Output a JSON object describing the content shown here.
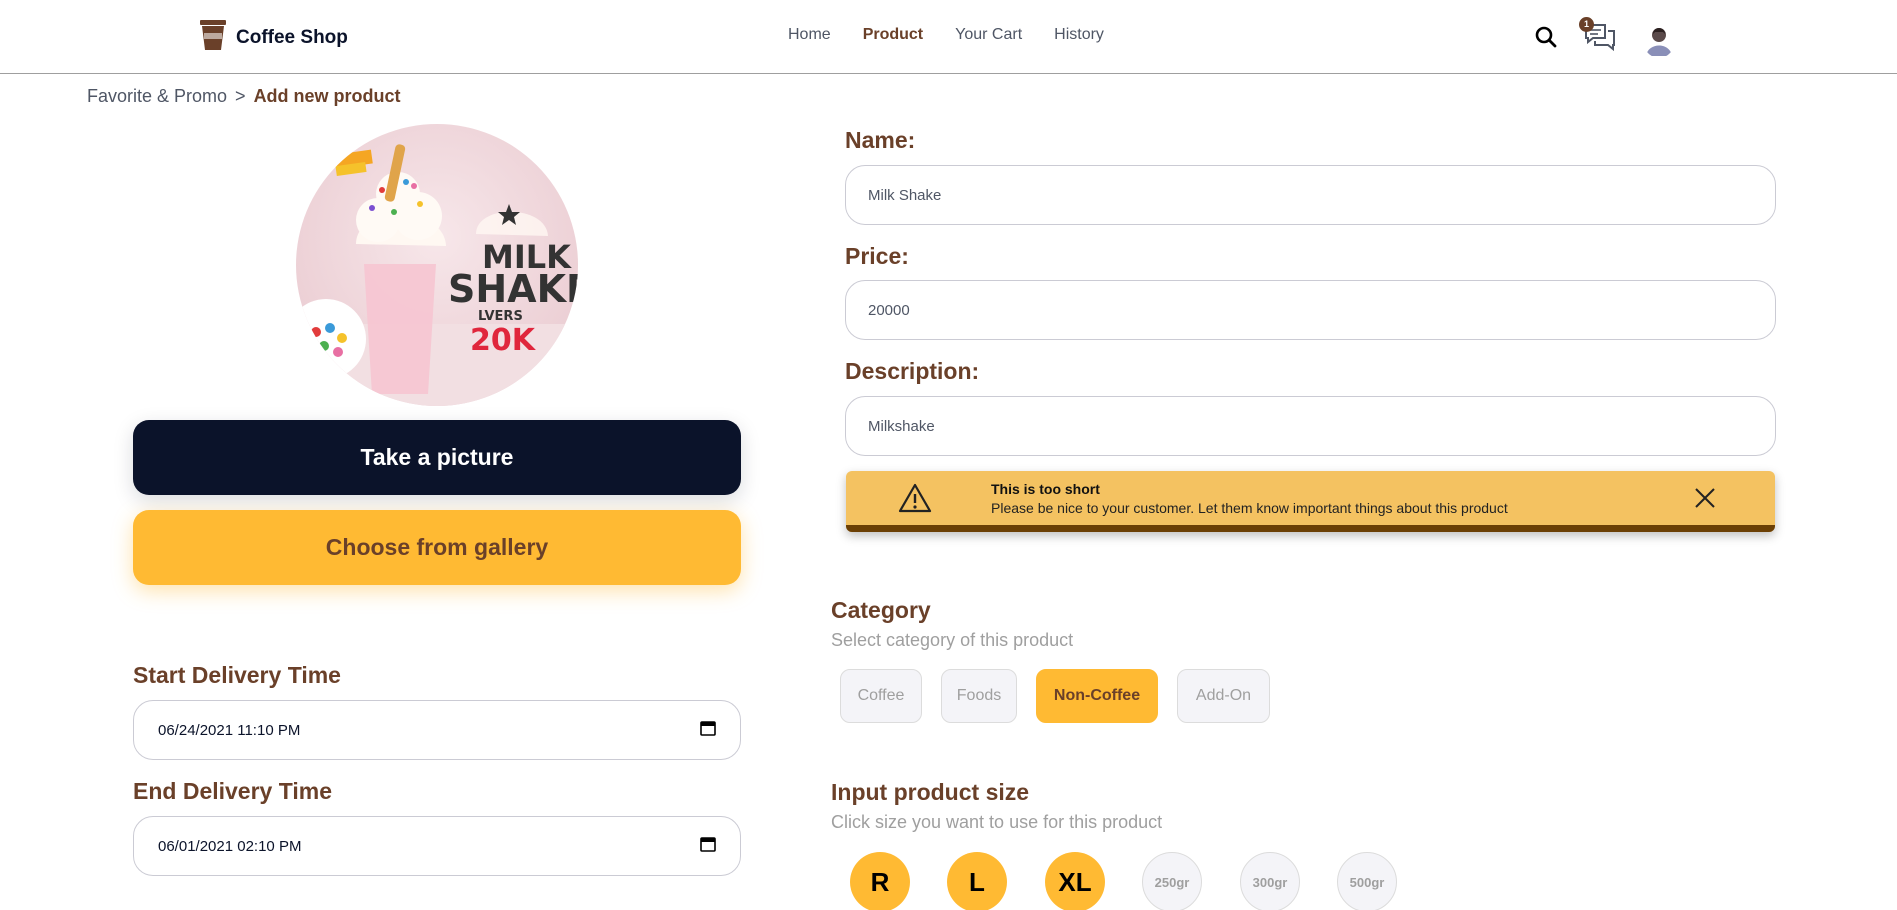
{
  "header": {
    "brand": "Coffee Shop",
    "nav": [
      "Home",
      "Product",
      "Your Cart",
      "History"
    ],
    "active_nav": "Product",
    "chat_badge": "1",
    "icons": [
      "search-icon",
      "chat-icon",
      "avatar"
    ]
  },
  "breadcrumb": {
    "parent": "Favorite & Promo",
    "separator": ">",
    "current": "Add new product"
  },
  "image_panel": {
    "take_picture_label": "Take a picture",
    "choose_gallery_label": "Choose from gallery",
    "image_text": {
      "line1": "MILK",
      "line2": "SHAKE",
      "line3": "LVERS",
      "price": "20K"
    }
  },
  "delivery": {
    "start_label": "Start Delivery Time",
    "start_value": "06/24/2021 11:10 PM",
    "end_label": "End Delivery Time",
    "end_value": "06/01/2021 02:10 PM"
  },
  "form": {
    "name_label": "Name:",
    "name_value": "Milk Shake",
    "price_label": "Price:",
    "price_value": "20000",
    "description_label": "Description:",
    "description_value": "Milkshake"
  },
  "alert": {
    "title": "This is too short",
    "message": "Please be nice to your customer. Let them know important things about this product"
  },
  "category": {
    "title": "Category",
    "subtitle": "Select category of this product",
    "options": [
      "Coffee",
      "Foods",
      "Non-Coffee",
      "Add-On"
    ],
    "selected": "Non-Coffee"
  },
  "size": {
    "title": "Input product size",
    "subtitle": "Click size you want to use for this product",
    "options": [
      "R",
      "L",
      "XL",
      "250gr",
      "300gr",
      "500gr"
    ]
  },
  "colors": {
    "brown": "#6a4029",
    "yellow": "#ffba33",
    "navy": "#0b132a",
    "alert": "#f4c261"
  }
}
